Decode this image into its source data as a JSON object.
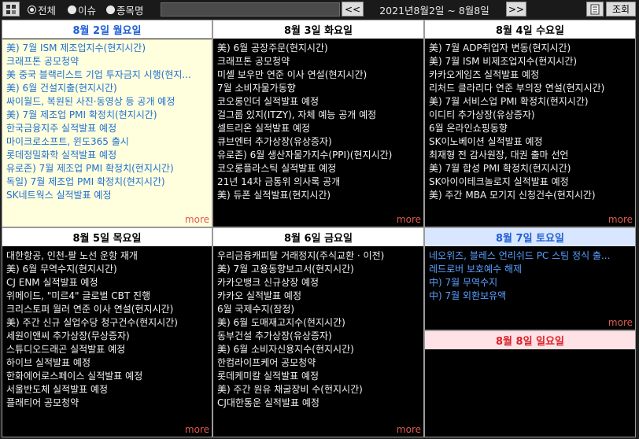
{
  "toolbar": {
    "filters": [
      {
        "label": "전체",
        "selected": true
      },
      {
        "label": "이슈",
        "selected": false
      },
      {
        "label": "종목명",
        "selected": false
      }
    ],
    "search_value": "",
    "prev_label": "<<",
    "date_range": "2021년8월2일 ~ 8월8일",
    "next_label": ">>",
    "search_button_label": "조회"
  },
  "days": [
    {
      "header": "8월 2일 월요일",
      "events": [
        "美) 7월 ISM 제조업지수(현지시간)",
        "크래프톤 공모청약",
        "美 중국 블랙리스트 기업 투자금지 시행(현지...",
        "美) 6월 건설지출(현지시간)",
        "싸이월드, 복원된 사진·동영상 등 공개 예정",
        "美) 7월 제조업 PMI 확정치(현지시간)",
        "한국금융지주 실적발표 예정",
        "마이크로소프트, 윈도365 출시",
        "롯데정밀화학 실적발표 예정",
        "유로존) 7월 제조업 PMI 확정치(현지시간)",
        "독일) 7월 제조업 PMI 확정치(현지시간)",
        "SK네트웍스 실적발표 예정"
      ],
      "more": "more"
    },
    {
      "header": "8월 3일 화요일",
      "events": [
        "美) 6월 공장주문(현지시간)",
        "크래프톤 공모청약",
        "미셸 보우만 연준 이사 연설(현지시간)",
        "7월 소비자물가동향",
        "코오롱인더 실적발표 예정",
        "걸그룹 있지(ITZY), 자체 예능 공개 예정",
        "셀트리온 실적발표 예정",
        "큐브엔터 추가상장(유상증자)",
        "유로존) 6월 생산자물가지수(PPI)(현지시간)",
        "코오롱플라스틱 실적발표 예정",
        "21년 14차 금통위 의사록 공개",
        "美) 듀폰 실적발표(현지시간)"
      ],
      "more": "more"
    },
    {
      "header": "8월 4일 수요일",
      "events": [
        "美) 7월 ADP취업자 변동(현지시간)",
        "美) 7월 ISM 비제조업지수(현지시간)",
        "카카오게임즈 실적발표 예정",
        "리처드 클라리다 연준 부의장 연설(현지시간)",
        "美) 7월 서비스업 PMI 확정치(현지시간)",
        "이디티 추가상장(유상증자)",
        "6월 온라인쇼핑동향",
        "SK이노베이션 실적발표 예정",
        "최재형 전 감사원장, 대권 출마 선언",
        "美) 7월 합성 PMI 확정치(현지시간)",
        "SK아이이테크놀로지 실적발표 예정",
        "美) 주간 MBA 모기지 신청건수(현지시간)"
      ],
      "more": "more"
    },
    {
      "header": "8월 5일 목요일",
      "events": [
        "대한항공, 인천-팔 노선 운항 재개",
        "美) 6월 무역수지(현지시간)",
        "CJ ENM 실적발표 예정",
        "위메이드, \"미르4\" 글로벌 CBT 진행",
        "크리스토퍼 월러 연준 이사 연설(현지시간)",
        "美) 주간 신규 실업수당 청구건수(현지시간)",
        "세원이앤씨 추가상장(무상증자)",
        "스튜디오드래곤 실적발표 예정",
        "하이브 실적발표 예정",
        "한화에어로스페이스 실적발표 예정",
        "서울반도체 실적발표 예정",
        "플래티어 공모청약"
      ],
      "more": "more"
    },
    {
      "header": "8월 6일 금요일",
      "events": [
        "우리금융캐피탈 거래정지(주식교환 · 이전)",
        "美) 7월 고용동향보고서(현지시간)",
        "카카오뱅크 신규상장 예정",
        "카카오 실적발표 예정",
        "6월 국제수지(잠정)",
        "美) 6월 도매재고지수(현지시간)",
        "동부건설 추가상장(유상증자)",
        "美) 6월 소비자신용지수(현지시간)",
        "한컴라이프케어 공모청약",
        "롯데케미칼 실적발표 예정",
        "美) 주간 원유 채굴장비 수(현지시간)",
        "CJ대한통운 실적발표 예정"
      ],
      "more": "more"
    },
    {
      "header": "8월 7일 토요일",
      "events": [
        "네오위즈, 블레스 언리쉬드 PC 스팀 정식 출...",
        "레드로버 보호예수 해제",
        "中) 7월 무역수지",
        "中) 7월 외환보유액"
      ],
      "more": "more"
    },
    {
      "header": "8월 8일 일요일",
      "events": [],
      "more": ""
    }
  ],
  "colors": {
    "today_bg": "#ffffdd",
    "today_text": "#1f6fd0",
    "saturday": "#1f5fd6",
    "sunday": "#d8232a",
    "more": "#e05a4e"
  }
}
